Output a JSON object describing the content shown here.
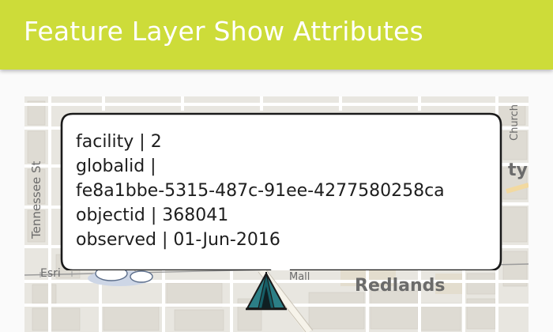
{
  "app": {
    "title": "Feature Layer Show Attributes",
    "accent_color": "#cddc39"
  },
  "callout": {
    "lines": [
      "facility | 2",
      "globalid |",
      "fe8a1bbe-5315-487c-91ee-4277580258ca",
      "objectid | 368041",
      "observed | 01-Jun-2016"
    ]
  },
  "map": {
    "labels": {
      "street_tennessee": "Tennessee St",
      "redlands": "Redlands",
      "esri_partial": "Esri",
      "mall_partial": "Mall",
      "church_partial": "Church",
      "right_partial": "ty"
    },
    "marker_icon": "campsite-tent-icon"
  }
}
